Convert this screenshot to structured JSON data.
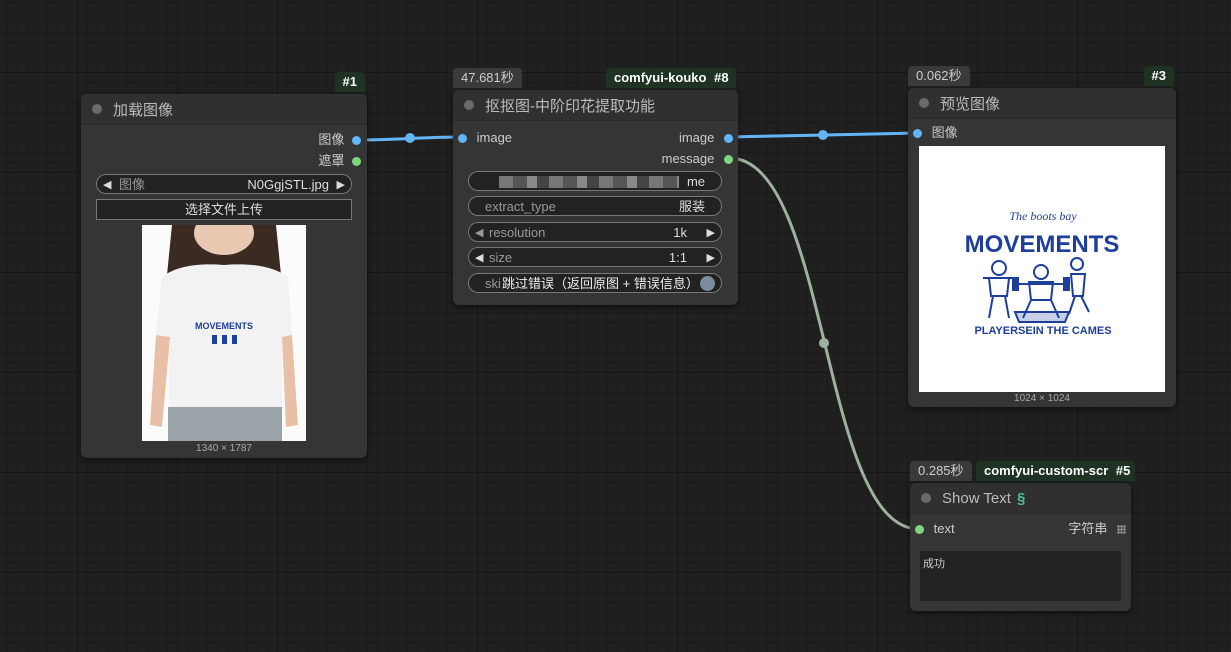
{
  "nodes": {
    "load_image": {
      "id": "#1",
      "title": "加载图像",
      "outputs": [
        "图像",
        "遮罩"
      ],
      "image_widget": {
        "label": "图像",
        "value": "N0GgjSTL.jpg"
      },
      "upload_label": "选择文件上传",
      "shirt_text": "MOVEMENTS",
      "dimensions": "1340 × 1787"
    },
    "extract": {
      "id": "#8",
      "time": "47.681秒",
      "source": "comfyui-kouko",
      "title": "抠抠图-中阶印花提取功能",
      "input": "image",
      "outputs": [
        "image",
        "message"
      ],
      "api_suffix": "me",
      "widgets": [
        {
          "label": "extract_type",
          "value": "服装"
        },
        {
          "label": "resolution",
          "value": "1k"
        },
        {
          "label": "size",
          "value": "1:1"
        }
      ],
      "toggle": {
        "label_prefix": "ski",
        "label": "跳过错误（返回原图 + 错误信息）",
        "enabled": false
      }
    },
    "preview": {
      "id": "#3",
      "time": "0.062秒",
      "title": "预览图像",
      "input": "图像",
      "art": {
        "script": "The boots bay",
        "headline": "MOVEMENTS",
        "footer": "PLAYERSEIN THE CAMES"
      },
      "dimensions": "1024 × 1024"
    },
    "show_text": {
      "id": "#5",
      "time": "0.285秒",
      "source": "comfyui-custom-scr",
      "title": "Show Text",
      "input": "text",
      "output": "字符串",
      "content": "成功"
    }
  },
  "colors": {
    "image_link": "#64b5f6",
    "string_link": "#9eb09e",
    "badge_green": "#1e3324",
    "print_blue": "#1d3f9a"
  }
}
